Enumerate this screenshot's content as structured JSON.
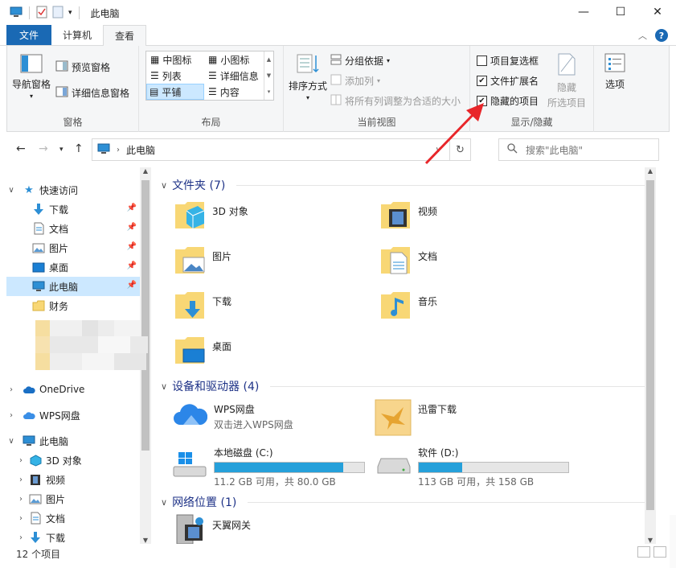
{
  "window": {
    "title": "此电脑",
    "controls": {
      "minimize": "—",
      "maximize": "☐",
      "close": "✕"
    }
  },
  "ribbon_tabs": [
    {
      "label": "文件"
    },
    {
      "label": "计算机"
    },
    {
      "label": "查看"
    }
  ],
  "ribbon": {
    "pane": {
      "nav_pane": "导航窗格",
      "preview_pane": "预览窗格",
      "details_pane": "详细信息窗格",
      "group_label": "窗格"
    },
    "layout": {
      "items": [
        "中图标",
        "小图标",
        "列表",
        "详细信息",
        "平铺",
        "内容"
      ],
      "group_label": "布局"
    },
    "current_view": {
      "sort_by": "排序方式",
      "group_by": "分组依据",
      "add_column": "添加列",
      "fit_columns": "将所有列调整为合适的大小",
      "group_label": "当前视图"
    },
    "show_hide": {
      "item_checkboxes": "项目复选框",
      "file_extensions": "文件扩展名",
      "hidden_items": "隐藏的项目",
      "hide": "隐藏",
      "selected_items": "所选项目",
      "group_label": "显示/隐藏",
      "item_checkboxes_checked": false,
      "file_extensions_checked": true,
      "hidden_items_checked": true
    },
    "options": {
      "label": "选项"
    }
  },
  "address": {
    "location": "此电脑",
    "search_placeholder": "搜索\"此电脑\""
  },
  "nav_tree": [
    {
      "label": "快速访问",
      "expanded": true
    },
    {
      "label": "下载",
      "pinned": true
    },
    {
      "label": "文档",
      "pinned": true
    },
    {
      "label": "图片",
      "pinned": true
    },
    {
      "label": "桌面",
      "pinned": true
    },
    {
      "label": "此电脑",
      "pinned": true,
      "selected": true
    },
    {
      "label": "财务"
    },
    {
      "label": "OneDrive",
      "expanded": false
    },
    {
      "label": "WPS网盘",
      "expanded": false
    },
    {
      "label": "此电脑",
      "expanded": true
    },
    {
      "label": "3D 对象"
    },
    {
      "label": "视频"
    },
    {
      "label": "图片"
    },
    {
      "label": "文档"
    },
    {
      "label": "下载"
    }
  ],
  "sections": {
    "folders": {
      "title": "文件夹 (7)",
      "items": [
        "3D 对象",
        "视频",
        "图片",
        "文档",
        "下载",
        "音乐",
        "桌面"
      ]
    },
    "devices": {
      "title": "设备和驱动器 (4)",
      "wps": {
        "name": "WPS网盘",
        "sub": "双击进入WPS网盘"
      },
      "thunder": {
        "name": "迅雷下载"
      },
      "c_drive": {
        "name": "本地磁盘 (C:)",
        "info": "11.2 GB 可用，共 80.0 GB",
        "used_fraction": 0.86
      },
      "d_drive": {
        "name": "软件 (D:)",
        "info": "113 GB 可用，共 158 GB",
        "used_fraction": 0.29
      }
    },
    "network": {
      "title": "网络位置 (1)",
      "items": [
        "天翼网关"
      ]
    }
  },
  "status": {
    "count": "12 个项目"
  },
  "colors": {
    "accent": "#1a69b4",
    "selection": "#cce8ff",
    "drive_bar": "#26a0da",
    "annotation_arrow": "#e8262a",
    "folder": "#f8d775"
  }
}
